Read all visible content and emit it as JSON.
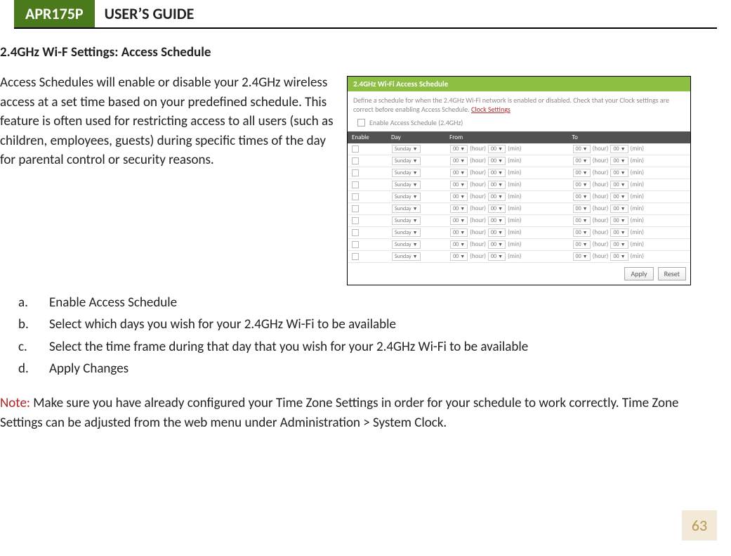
{
  "header": {
    "model": "APR175P",
    "title": "USER’S GUIDE"
  },
  "section_title": "2.4GHz Wi-F Settings: Access Schedule",
  "intro": "Access Schedules will enable or disable your 2.4GHz wireless access at a set time based on your predefined schedule.  This feature is often used for restricting access to all users (such as children, employees, guests) during specific times of the day for parental control or security reasons.",
  "steps": [
    "Enable Access Schedule",
    "Select which days you wish for your 2.4GHz Wi-Fi to be available",
    "Select the time frame during that day that you wish for your 2.4GHz Wi-Fi to be available",
    "Apply Changes"
  ],
  "step_markers": [
    "a.",
    "b.",
    "c.",
    "d."
  ],
  "note_label": "Note:",
  "note_text": "  Make sure you have already configured your Time Zone Settings in order for your schedule to work correctly. Time Zone Settings can be adjusted from the web menu under Administration > System Clock.",
  "figure": {
    "panel_title": "2.4GHz Wi-Fi Access Schedule",
    "desc_pre": "Define a schedule for when the 2.4GHz Wi-Fi network is enabled or disabled. Check that your Clock settings are correct before enabling Access Schedule. ",
    "desc_link": "Clock Settings",
    "enable_label": "Enable Access Schedule (2.4GHz)",
    "cols": {
      "enable": "Enable",
      "day": "Day",
      "from": "From",
      "to": "To"
    },
    "row_count": 10,
    "day_value": "Sunday",
    "hour_value": "00",
    "hour_suffix": "(hour)",
    "min_value": "00",
    "min_suffix": "(min)",
    "apply": "Apply",
    "reset": "Reset"
  },
  "page_number": "63"
}
